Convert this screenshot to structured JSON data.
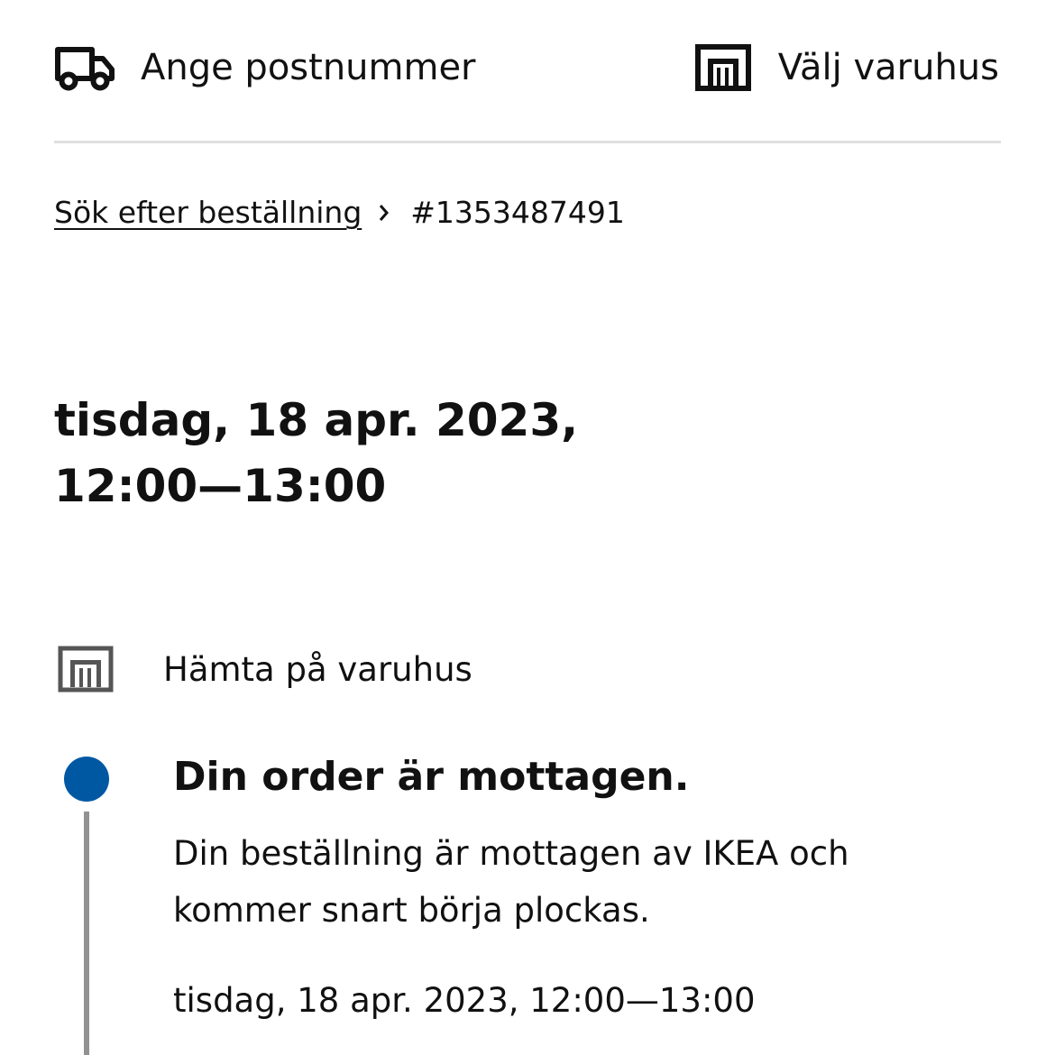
{
  "header": {
    "postcode_label": "Ange postnummer",
    "postcode_icon": "delivery-truck-icon",
    "store_label": "Välj varuhus",
    "store_icon": "store-icon"
  },
  "breadcrumb": {
    "link_label": "Sök efter beställning",
    "separator_icon": "chevron-right-icon",
    "current": "#1353487491"
  },
  "order": {
    "date_line": "tisdag, 18 apr. 2023,",
    "time_line": "12:00—13:00"
  },
  "pickup": {
    "icon": "store-icon",
    "label": "Hämta på varuhus"
  },
  "timeline": {
    "active_color": "#0058a3",
    "line_color": "#929292",
    "steps": [
      {
        "title": "Din order är mottagen.",
        "description": "Din beställning är mottagen av IKEA och kommer snart börja plockas.",
        "time": "tisdag, 18 apr. 2023, 12:00—13:00"
      }
    ]
  }
}
